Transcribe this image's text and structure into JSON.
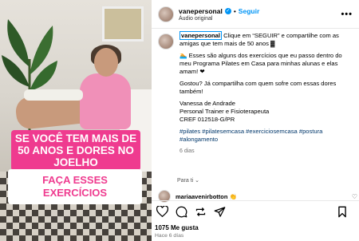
{
  "media": {
    "overlay_top": "SE VOCÊ TEM MAIS DE 50 ANOS E DORES NO JOELHO",
    "overlay_bottom": "FAÇA ESSES EXERCÍCIOS"
  },
  "header": {
    "username": "vanepersonal",
    "follow": "Seguir",
    "separator": "•",
    "audio": "Áudio original",
    "more": "•••"
  },
  "caption": {
    "username": "vanepersonal",
    "line1": "Clique em “SEGUIR” e compartilhe com as amigas que tem mais de 50 anos ▓",
    "line2": "🏊 Esses são alguns dos exercícios que eu passo dentro do meu Programa Pilates em Casa para minhas alunas e elas amam! ❤",
    "line3": "Gostou? Já compartilha com quem sofre com essas dores também!",
    "sig1": "Vanessa de Andrade",
    "sig2": "Personal Trainer e Fisioterapeuta",
    "sig3": "CREF 012518-G/PR",
    "tags": "#pilates #pilatesemcasa #exerciciosemcasa #postura #alongamento",
    "time": "6 dias"
  },
  "translate": "Para ti ⌄",
  "comment": {
    "username": "mariaavenirbotton",
    "text": "👏"
  },
  "stats": {
    "likes": "1075 Me gusta",
    "date": "Hace 6 días"
  },
  "colors": {
    "brand_pink": "#ef3b8f",
    "link_blue": "#0095f6",
    "tag_blue": "#00376b"
  }
}
